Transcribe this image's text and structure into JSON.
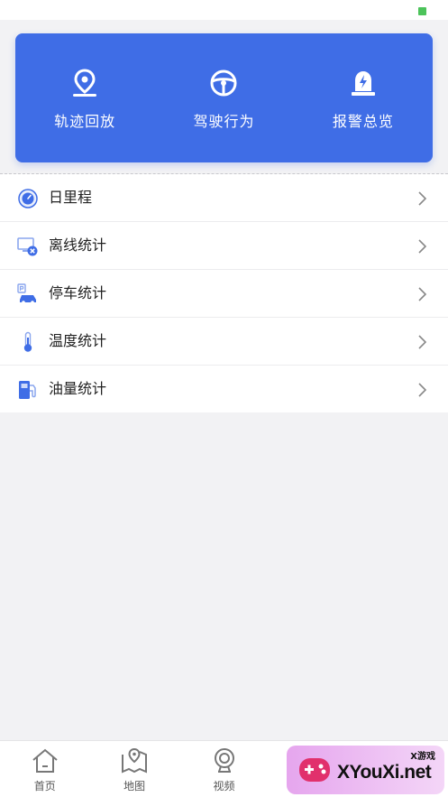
{
  "actions": [
    {
      "label": "轨迹回放",
      "icon": "location-pin-icon"
    },
    {
      "label": "驾驶行为",
      "icon": "steering-wheel-icon"
    },
    {
      "label": "报警总览",
      "icon": "alarm-light-icon"
    }
  ],
  "menu": [
    {
      "label": "日里程",
      "icon": "odometer-icon"
    },
    {
      "label": "离线统计",
      "icon": "offline-monitor-icon"
    },
    {
      "label": "停车统计",
      "icon": "parking-car-icon"
    },
    {
      "label": "温度统计",
      "icon": "thermometer-icon"
    },
    {
      "label": "油量统计",
      "icon": "fuel-pump-icon"
    }
  ],
  "tabs": [
    {
      "label": "首页",
      "icon": "home-icon"
    },
    {
      "label": "地图",
      "icon": "map-icon"
    },
    {
      "label": "视频",
      "icon": "camera-icon"
    }
  ],
  "watermark": {
    "text": "XYouXi.net",
    "small": "X游戏"
  },
  "colors": {
    "accent": "#3f6de6",
    "background": "#f2f2f4",
    "status_green": "#4cc35a"
  }
}
